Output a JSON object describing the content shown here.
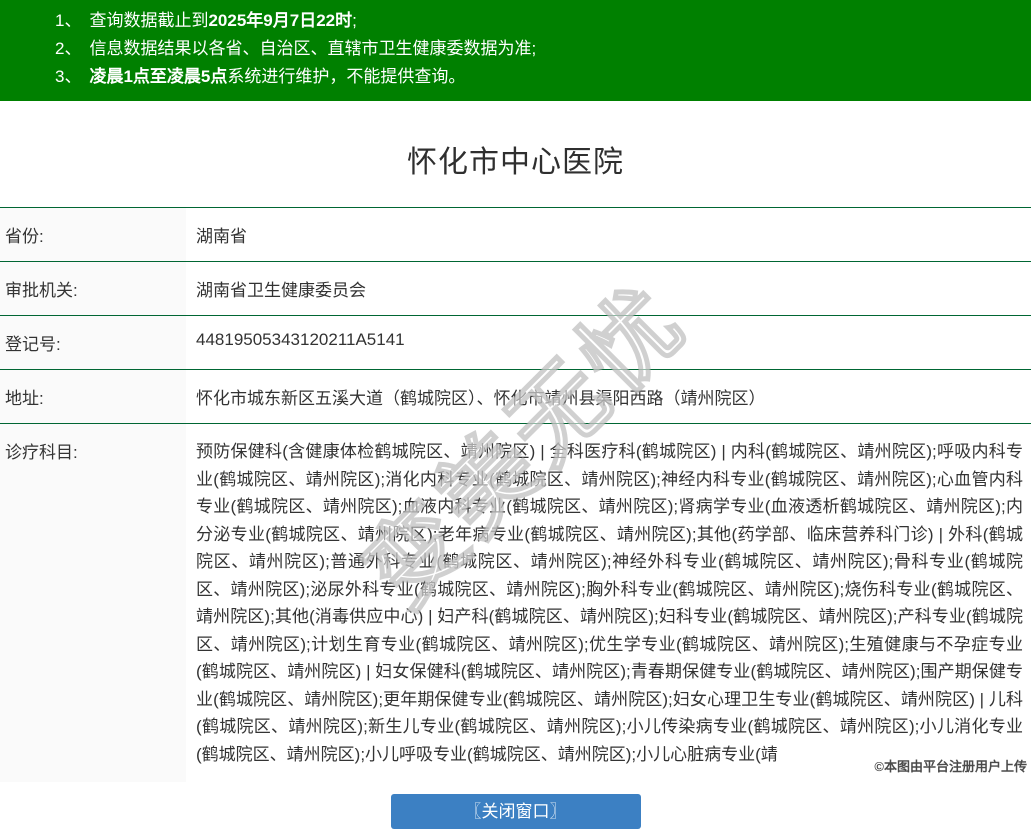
{
  "notice": {
    "lines": [
      {
        "num": "1、",
        "pre": "查询数据截止到",
        "bold": "2025年9月7日22时",
        "post": ";"
      },
      {
        "num": "2、",
        "pre": "信息数据结果以各省、自治区、直辖市卫生健康委数据为准;",
        "bold": "",
        "post": ""
      },
      {
        "num": "3、",
        "pre": "",
        "bold": "凌晨1点至凌晨5点",
        "post": "系统进行维护，不能提供查询。"
      }
    ]
  },
  "hospital": {
    "title": "怀化市中心医院"
  },
  "table": {
    "rows": [
      {
        "label": "省份:",
        "value": "湖南省"
      },
      {
        "label": "审批机关:",
        "value": "湖南省卫生健康委员会"
      },
      {
        "label": "登记号:",
        "value": "44819505343120211A5141"
      },
      {
        "label": "地址:",
        "value": "怀化市城东新区五溪大道（鹤城院区）、怀化市靖州县渠阳西路（靖州院区）"
      },
      {
        "label": "诊疗科目:",
        "value": "预防保健科(含健康体检鹤城院区、靖州院区) | 全科医疗科(鹤城院区) | 内科(鹤城院区、靖州院区);呼吸内科专业(鹤城院区、靖州院区);消化内科专业(鹤城院区、靖州院区);神经内科专业(鹤城院区、靖州院区);心血管内科专业(鹤城院区、靖州院区);血液内科专业(鹤城院区、靖州院区);肾病学专业(血液透析鹤城院区、靖州院区);内分泌专业(鹤城院区、靖州院区);老年病专业(鹤城院区、靖州院区);其他(药学部、临床营养科门诊) | 外科(鹤城院区、靖州院区);普通外科专业(鹤城院区、靖州院区);神经外科专业(鹤城院区、靖州院区);骨科专业(鹤城院区、靖州院区);泌尿外科专业(鹤城院区、靖州院区);胸外科专业(鹤城院区、靖州院区);烧伤科专业(鹤城院区、靖州院区);其他(消毒供应中心) | 妇产科(鹤城院区、靖州院区);妇科专业(鹤城院区、靖州院区);产科专业(鹤城院区、靖州院区);计划生育专业(鹤城院区、靖州院区);优生学专业(鹤城院区、靖州院区);生殖健康与不孕症专业(鹤城院区、靖州院区) | 妇女保健科(鹤城院区、靖州院区);青春期保健专业(鹤城院区、靖州院区);围产期保健专业(鹤城院区、靖州院区);更年期保健专业(鹤城院区、靖州院区);妇女心理卫生专业(鹤城院区、靖州院区) | 儿科(鹤城院区、靖州院区);新生儿专业(鹤城院区、靖州院区);小儿传染病专业(鹤城院区、靖州院区);小儿消化专业(鹤城院区、靖州院区);小儿呼吸专业(鹤城院区、靖州院区);小儿心脏病专业(靖"
      }
    ]
  },
  "footer": {
    "close_button_label": "〖关闭窗口〗",
    "credit": "©本图由平台注册用户上传"
  },
  "watermark_text": "变美无忧",
  "colors": {
    "banner_green": "#008000",
    "divider_green": "#006633",
    "button_blue": "#3c80c3",
    "label_column_bg": "#fafafa"
  }
}
